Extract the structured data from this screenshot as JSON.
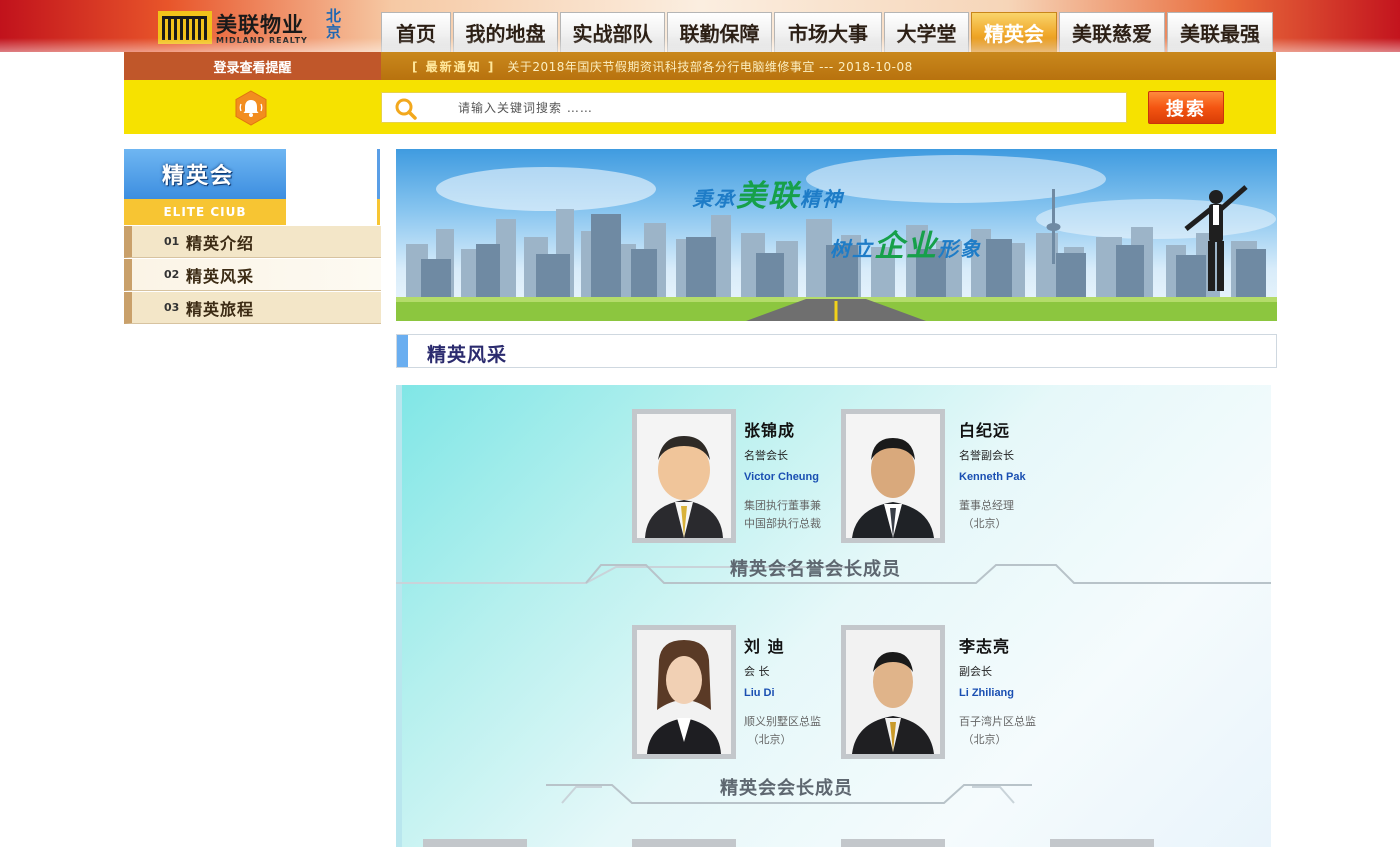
{
  "header": {
    "logo_cn": "美联物业",
    "logo_en": "MIDLAND REALTY",
    "logo_city": "北京",
    "nav": [
      {
        "label": "首页",
        "active": false
      },
      {
        "label": "我的地盘",
        "active": false
      },
      {
        "label": "实战部队",
        "active": false
      },
      {
        "label": "联勤保障",
        "active": false
      },
      {
        "label": "市场大事",
        "active": false
      },
      {
        "label": "大学堂",
        "active": false
      },
      {
        "label": "精英会",
        "active": true
      },
      {
        "label": "美联慈爱",
        "active": false
      },
      {
        "label": "美联最强",
        "active": false
      }
    ]
  },
  "notice": {
    "login_tip": "登录查看提醒",
    "label": "[ 最新通知 ]",
    "text": "关于2018年国庆节假期资讯科技部各分行电脑维修事宜 --- 2018-10-08"
  },
  "search": {
    "placeholder": "请输入关键词搜索 ……",
    "button": "搜索"
  },
  "sidebar": {
    "title": "精英会",
    "subtitle": "ELITE CIUB",
    "items": [
      {
        "num": "01",
        "label": "精英介绍"
      },
      {
        "num": "02",
        "label": "精英风采"
      },
      {
        "num": "03",
        "label": "精英旅程"
      }
    ]
  },
  "banner": {
    "line1_a": "秉承",
    "line1_b": "美联",
    "line1_c": "精神",
    "line2_a": "树立",
    "line2_b": "企业",
    "line2_c": "形象"
  },
  "section": {
    "title": "精英风采"
  },
  "groups": [
    {
      "label": "精英会名誉会长成员",
      "members": [
        {
          "name": "张锦成",
          "role": "名誉会长",
          "en": "Victor Cheung",
          "desc": "集团执行董事兼\n中国部执行总裁"
        },
        {
          "name": "白纪远",
          "role": "名誉副会长",
          "en": "Kenneth Pak",
          "desc": "董事总经理\n （北京）"
        }
      ]
    },
    {
      "label": "精英会会长成员",
      "members": [
        {
          "name": "刘  迪",
          "role": "会    长",
          "en": "Liu Di",
          "desc": "顺义别墅区总监\n （北京）"
        },
        {
          "name": "李志亮",
          "role": "副会长",
          "en": "Li Zhiliang",
          "desc": "百子湾片区总监\n （北京）"
        }
      ]
    }
  ],
  "colors": {
    "nav_active": "#f0a82a",
    "notice_bg": "#b8720e",
    "search_bg": "#f6e200",
    "search_btn": "#f45512",
    "sidebar_blue": "#3d8ee0",
    "sidebar_yellow": "#f7c533",
    "english_name": "#1a4fb2"
  }
}
